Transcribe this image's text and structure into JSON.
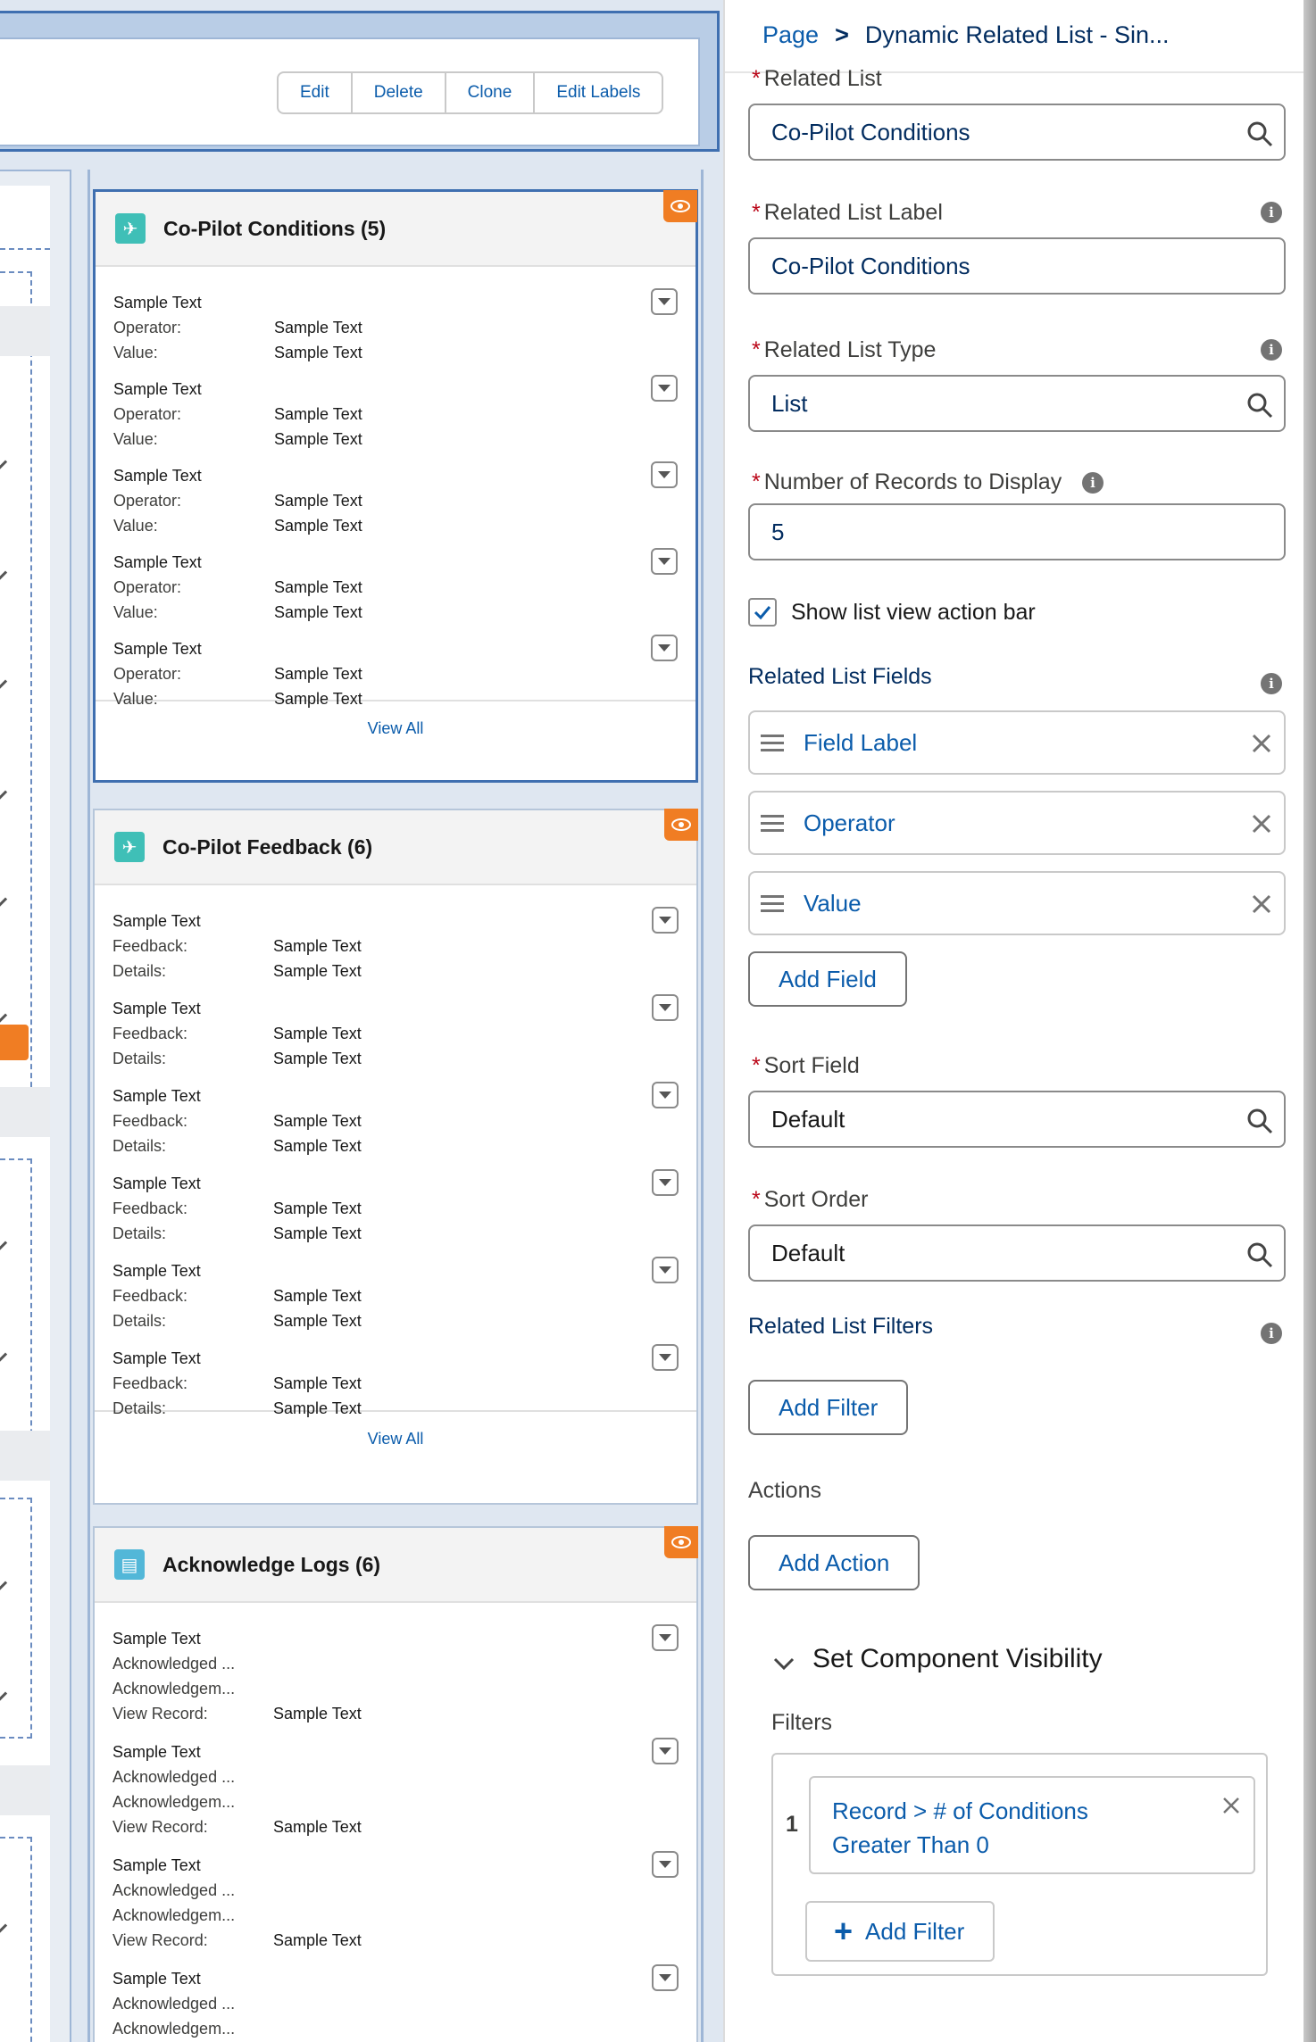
{
  "header": {
    "buttons": [
      "Edit",
      "Delete",
      "Clone",
      "Edit Labels"
    ]
  },
  "cards": [
    {
      "title": "Co-Pilot Conditions (5)",
      "icon": "co-pilot-icon",
      "icon_color": "#3fbfb7",
      "records": [
        {
          "name": "Sample Text",
          "f1": "Operator:",
          "v1": "Sample Text",
          "f2": "Value:",
          "v2": "Sample Text"
        },
        {
          "name": "Sample Text",
          "f1": "Operator:",
          "v1": "Sample Text",
          "f2": "Value:",
          "v2": "Sample Text"
        },
        {
          "name": "Sample Text",
          "f1": "Operator:",
          "v1": "Sample Text",
          "f2": "Value:",
          "v2": "Sample Text"
        },
        {
          "name": "Sample Text",
          "f1": "Operator:",
          "v1": "Sample Text",
          "f2": "Value:",
          "v2": "Sample Text"
        },
        {
          "name": "Sample Text",
          "f1": "Operator:",
          "v1": "Sample Text",
          "f2": "Value:",
          "v2": "Sample Text"
        }
      ],
      "view_all": "View All"
    },
    {
      "title": "Co-Pilot Feedback (6)",
      "icon": "co-pilot-icon",
      "icon_color": "#3fbfb7",
      "records": [
        {
          "name": "Sample Text",
          "f1": "Feedback:",
          "v1": "Sample Text",
          "f2": "Details:",
          "v2": "Sample Text"
        },
        {
          "name": "Sample Text",
          "f1": "Feedback:",
          "v1": "Sample Text",
          "f2": "Details:",
          "v2": "Sample Text"
        },
        {
          "name": "Sample Text",
          "f1": "Feedback:",
          "v1": "Sample Text",
          "f2": "Details:",
          "v2": "Sample Text"
        },
        {
          "name": "Sample Text",
          "f1": "Feedback:",
          "v1": "Sample Text",
          "f2": "Details:",
          "v2": "Sample Text"
        },
        {
          "name": "Sample Text",
          "f1": "Feedback:",
          "v1": "Sample Text",
          "f2": "Details:",
          "v2": "Sample Text"
        },
        {
          "name": "Sample Text",
          "f1": "Feedback:",
          "v1": "Sample Text",
          "f2": "Details:",
          "v2": "Sample Text"
        }
      ],
      "view_all": "View All"
    },
    {
      "title": "Acknowledge Logs (6)",
      "icon": "log-icon",
      "icon_color": "#52b7d8",
      "records": [
        {
          "name": "Sample Text",
          "f1": "Acknowledged ...",
          "f2": "Acknowledgem...",
          "f3": "View Record:",
          "v3": "Sample Text"
        },
        {
          "name": "Sample Text",
          "f1": "Acknowledged ...",
          "f2": "Acknowledgem...",
          "f3": "View Record:",
          "v3": "Sample Text"
        },
        {
          "name": "Sample Text",
          "f1": "Acknowledged ...",
          "f2": "Acknowledgem...",
          "f3": "View Record:",
          "v3": "Sample Text"
        },
        {
          "name": "Sample Text",
          "f1": "Acknowledged ...",
          "f2": "Acknowledgem..."
        }
      ]
    }
  ],
  "panel": {
    "breadcrumb": {
      "root": "Page",
      "sep": ">",
      "current": "Dynamic Related List - Sin..."
    },
    "related_list": {
      "label": "Related List",
      "value": "Co-Pilot Conditions"
    },
    "related_list_label": {
      "label": "Related List Label",
      "value": "Co-Pilot Conditions"
    },
    "related_list_type": {
      "label": "Related List Type",
      "value": "List"
    },
    "records_to_display": {
      "label": "Number of Records to Display",
      "value": "5"
    },
    "show_action_bar": {
      "label": "Show list view action bar",
      "checked": true
    },
    "fields_section": "Related List Fields",
    "fields": [
      "Field Label",
      "Operator",
      "Value"
    ],
    "add_field": "Add Field",
    "sort_field": {
      "label": "Sort Field",
      "value": "Default"
    },
    "sort_order": {
      "label": "Sort Order",
      "value": "Default"
    },
    "filters_section": "Related List Filters",
    "add_filter": "Add Filter",
    "actions_label": "Actions",
    "add_action": "Add Action",
    "visibility": {
      "title": "Set Component Visibility",
      "filters_label": "Filters",
      "filter_index": "1",
      "filter_line1": "Record > # of Conditions",
      "filter_line2": "Greater Than 0",
      "add_filter": "Add Filter"
    }
  },
  "colors": {
    "accent": "#0b5cab",
    "warning_badge": "#f07d23",
    "required": "#ba0517"
  }
}
